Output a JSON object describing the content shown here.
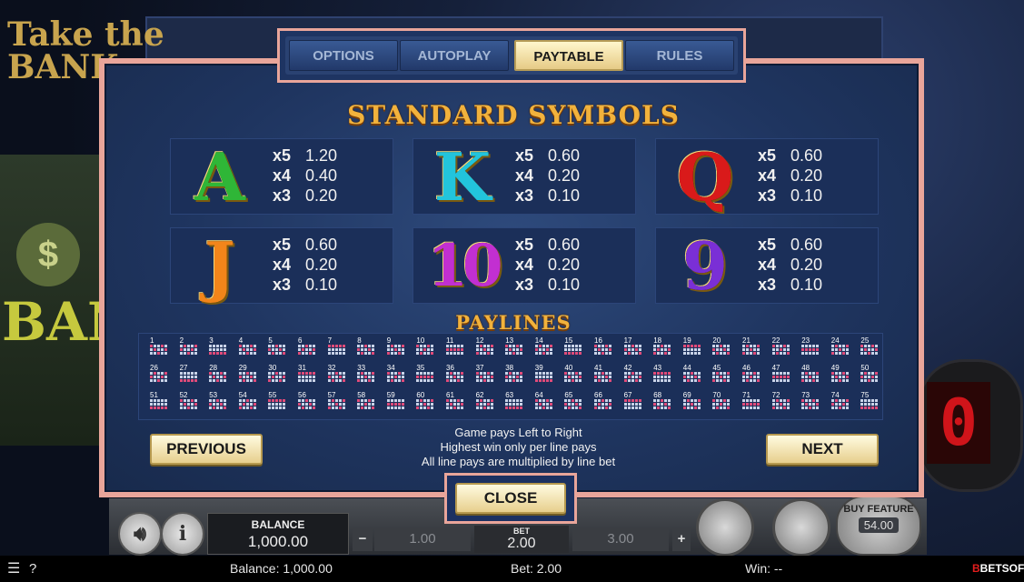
{
  "game": {
    "logo_line1": "Take the",
    "logo_line2": "BANK",
    "bank_sign": "BANK",
    "bomb_digit": "0"
  },
  "tabs": [
    {
      "label": "OPTIONS",
      "active": false
    },
    {
      "label": "AUTOPLAY",
      "active": false
    },
    {
      "label": "PAYTABLE",
      "active": true
    },
    {
      "label": "RULES",
      "active": false
    }
  ],
  "paytable": {
    "title": "STANDARD SYMBOLS",
    "symbols": [
      {
        "glyph": "A",
        "color": "#2fb637",
        "pays": [
          {
            "m": "x5",
            "v": "1.20"
          },
          {
            "m": "x4",
            "v": "0.40"
          },
          {
            "m": "x3",
            "v": "0.20"
          }
        ]
      },
      {
        "glyph": "K",
        "color": "#22c4dc",
        "pays": [
          {
            "m": "x5",
            "v": "0.60"
          },
          {
            "m": "x4",
            "v": "0.20"
          },
          {
            "m": "x3",
            "v": "0.10"
          }
        ]
      },
      {
        "glyph": "Q",
        "color": "#d91a1a",
        "pays": [
          {
            "m": "x5",
            "v": "0.60"
          },
          {
            "m": "x4",
            "v": "0.20"
          },
          {
            "m": "x3",
            "v": "0.10"
          }
        ]
      },
      {
        "glyph": "J",
        "color": "#f2851a",
        "pays": [
          {
            "m": "x5",
            "v": "0.60"
          },
          {
            "m": "x4",
            "v": "0.20"
          },
          {
            "m": "x3",
            "v": "0.10"
          }
        ]
      },
      {
        "glyph": "10",
        "color": "#c22fd1",
        "pays": [
          {
            "m": "x5",
            "v": "0.60"
          },
          {
            "m": "x4",
            "v": "0.20"
          },
          {
            "m": "x3",
            "v": "0.10"
          }
        ]
      },
      {
        "glyph": "9",
        "color": "#7a2fd6",
        "pays": [
          {
            "m": "x5",
            "v": "0.60"
          },
          {
            "m": "x4",
            "v": "0.20"
          },
          {
            "m": "x3",
            "v": "0.10"
          }
        ]
      }
    ],
    "paylines_title": "PAYLINES",
    "payline_count": 75,
    "rules_lines": [
      "Game pays Left to Right",
      "Highest win only per line pays",
      "All line pays are multiplied by line bet"
    ],
    "previous_label": "PREVIOUS",
    "next_label": "NEXT",
    "close_label": "CLOSE"
  },
  "controls": {
    "balance_label": "BALANCE",
    "balance_value": "1,000.00",
    "bet_label": "BET",
    "bet_value": "2.00",
    "bet_lower": "1.00",
    "bet_higher": "3.00",
    "minus": "−",
    "plus": "+",
    "sound_icon": "speaker-icon",
    "info_icon": "info-icon",
    "buy_feature_label": "BUY FEATURE",
    "buy_feature_value": "54.00"
  },
  "statusbar": {
    "balance": "Balance: 1,000.00",
    "bet": "Bet: 2.00",
    "win": "Win: --",
    "brand": "BETSOFT",
    "menu_icon": "hamburger-icon",
    "help_icon": "question-icon"
  },
  "colors": {
    "panel_border": "#e9a59a",
    "title_gold": "#f2b23c",
    "payline_on": "#e14b7a"
  }
}
